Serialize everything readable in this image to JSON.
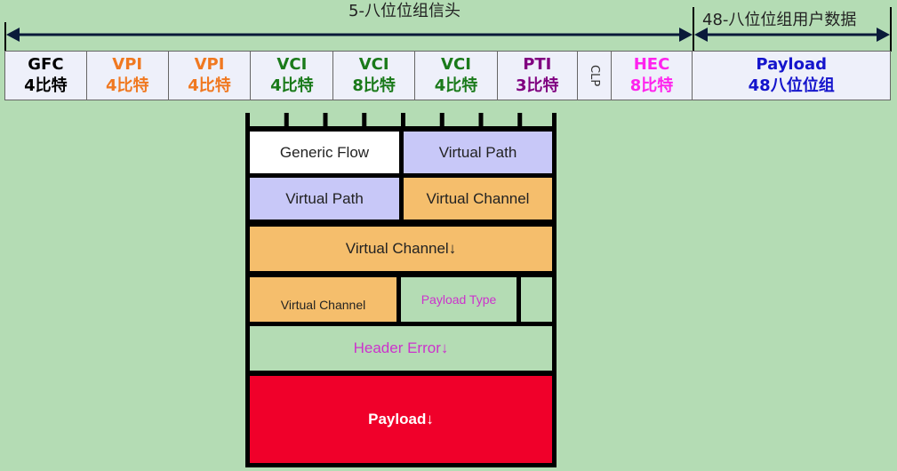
{
  "header": {
    "title": "5-八位位组信头",
    "payload_title": "48-八位位组用户数据"
  },
  "colors": {
    "background": "#b4dcb4",
    "gfc": "#000000",
    "vpi": "#f07820",
    "vci": "#1a7a1a",
    "pti": "#800080",
    "hec": "#ff22ee",
    "payload": "#1414cc",
    "orange_box": "#f5be6c",
    "lavender_box": "#c8c8f8",
    "red_box": "#f0002a"
  },
  "fields": [
    {
      "name": "GFC",
      "bits": "4比特",
      "color": "#000000"
    },
    {
      "name": "VPI",
      "bits": "4比特",
      "color": "#f07820"
    },
    {
      "name": "VPI",
      "bits": "4比特",
      "color": "#f07820"
    },
    {
      "name": "VCI",
      "bits": "4比特",
      "color": "#1a7a1a"
    },
    {
      "name": "VCI",
      "bits": "8比特",
      "color": "#1a7a1a"
    },
    {
      "name": "VCI",
      "bits": "4比特",
      "color": "#1a7a1a"
    },
    {
      "name": "PTI",
      "bits": "3比特",
      "color": "#800080"
    },
    {
      "name": "CLP",
      "bits": "",
      "color": "#333333"
    },
    {
      "name": "HEC",
      "bits": "8比特",
      "color": "#ff22ee"
    },
    {
      "name": "Payload",
      "bits": "48八位位组",
      "color": "#1414cc"
    }
  ],
  "diagram": {
    "generic_flow": "Generic Flow",
    "virtual_path_1": "Virtual Path",
    "virtual_path_2": "Virtual Path",
    "virtual_channel_1": "Virtual Channel",
    "virtual_channel_2": "Virtual Channel↓",
    "virtual_channel_3": "Virtual Channel",
    "payload_type": "Payload Type",
    "header_error": "Header Error↓",
    "payload": "Payload↓"
  }
}
